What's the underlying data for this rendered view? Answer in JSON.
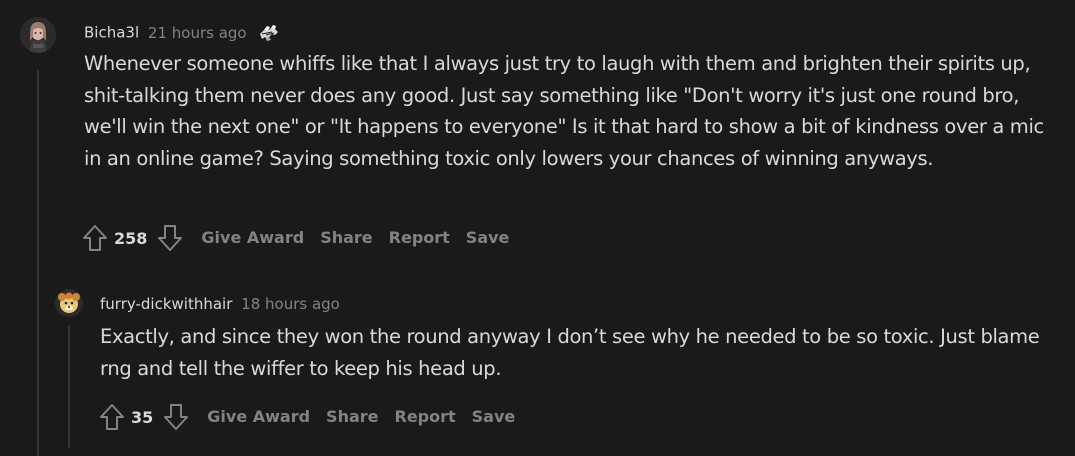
{
  "comments": [
    {
      "username": "Bicha3l",
      "timestamp": "21 hours ago",
      "body": "Whenever someone whiffs like that I always just try to laugh with them and brighten their spirits up, shit-talking them never does any good. Just say something like \"Don't worry it's just one round bro, we'll win the next one\" or \"It happens to everyone\" Is it that hard to show a bit of kindness over a mic in an online game? Saying something toxic only lowers your chances of winning anyways.",
      "score": "258",
      "actions": {
        "give_award": "Give Award",
        "share": "Share",
        "report": "Report",
        "save": "Save"
      }
    },
    {
      "username": "furry-dickwithhair",
      "timestamp": "18 hours ago",
      "body": "Exactly, and since they won the round anyway I don’t see why he needed to be so toxic. Just blame rng and tell the wiffer to keep his head up.",
      "score": "35",
      "actions": {
        "give_award": "Give Award",
        "share": "Share",
        "report": "Report",
        "save": "Save"
      }
    }
  ],
  "icons": {
    "award": "award-icon",
    "upvote": "upvote-arrow-icon",
    "downvote": "downvote-arrow-icon"
  },
  "colors": {
    "background": "#1a1a1b",
    "text": "#d7dadc",
    "muted": "#818384",
    "thread_line": "#343536"
  }
}
